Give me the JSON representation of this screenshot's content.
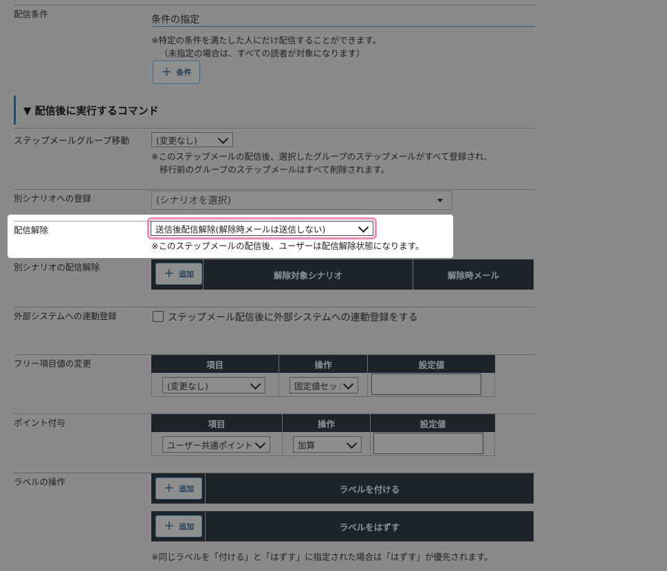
{
  "conditions": {
    "label": "配信条件",
    "title": "条件の指定",
    "note1": "※特定の条件を満たした人にだけ配信することができます。",
    "note2": "（未指定の場合は、すべての読者が対象になります）",
    "add_label": "条件"
  },
  "section_title": "▼ 配信後に実行するコマンド",
  "step_group": {
    "label": "ステップメールグループ移動",
    "value": "(変更なし)",
    "note1": "※このステップメールの配信後、選択したグループのステップメールがすべて登録され、",
    "note2": "移行前のグループのステップメールはすべて削除されます。"
  },
  "scenario_register": {
    "label": "別シナリオへの登録",
    "placeholder": "(シナリオを選択)"
  },
  "unsubscribe": {
    "label": "配信解除",
    "value": "送信後配信解除(解除時メールは送信しない)",
    "note": "※このステップメールの配信後、ユーザーは配信解除状態になります。"
  },
  "scenario_unsub": {
    "label": "別シナリオの配信解除",
    "add_label": "追加",
    "col1": "解除対象シナリオ",
    "col2": "解除時メール"
  },
  "external": {
    "label": "外部システムへの連動登録",
    "checkbox_label": "ステップメール配信後に外部システムへの連動登録をする"
  },
  "free_item": {
    "label": "フリー項目値の変更",
    "headers": [
      "項目",
      "操作",
      "設定値"
    ],
    "item_value": "(変更なし)",
    "op_value": "固定値セット"
  },
  "points": {
    "label": "ポイント付与",
    "headers": [
      "項目",
      "操作",
      "設定値"
    ],
    "item_value": "ユーザー共通ポイント",
    "op_value": "加算"
  },
  "labels_op": {
    "label": "ラベルの操作",
    "add_label": "追加",
    "attach": "ラベルを付ける",
    "detach": "ラベルをはずす",
    "note": "※同じラベルを「付ける」と「はずす」に指定された場合は「はずす」が優先されます。"
  },
  "colors": {
    "highlight": "#f28ab8",
    "dark_bar": "#1d2328",
    "accent": "#3e6b88"
  }
}
